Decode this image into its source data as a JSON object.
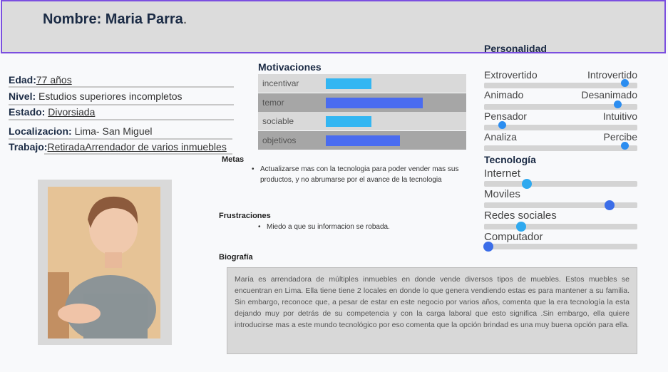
{
  "header": {
    "label": "Nombre:",
    "name": "Maria Parra",
    "suffix": "."
  },
  "profile": {
    "edad": {
      "label": "Edad:",
      "value": "77 años"
    },
    "nivel": {
      "label": "Nivel:",
      "value": "Estudios superiores incompletos"
    },
    "estado": {
      "label": "Estado:",
      "value": "Divorsiada"
    },
    "localizacion": {
      "label": "Localizacion:",
      "value": "Lima- San Miguel"
    },
    "trabajo": {
      "label": "Trabajo:",
      "value": "RetiradaArrendador de varios inmuebles"
    }
  },
  "motivaciones": {
    "title": "Motivaciones",
    "items": [
      {
        "label": "incentivar",
        "level": 0.22,
        "color": "#33b6f2",
        "shade": "#d9d9d9"
      },
      {
        "label": "temor",
        "level": 0.47,
        "color": "#4a6cf0",
        "shade": "#a6a6a6"
      },
      {
        "label": "sociable",
        "level": 0.22,
        "color": "#33b6f2",
        "shade": "#d9d9d9"
      },
      {
        "label": "objetivos",
        "level": 0.36,
        "color": "#4a6cf0",
        "shade": "#a6a6a6"
      }
    ]
  },
  "metas": {
    "title": "Metas",
    "items": [
      "Actualizarse mas con la tecnologia para poder vender mas sus productos, y no abrumarse por el avance de la tecnologia"
    ]
  },
  "frustraciones": {
    "title": "Frustraciones",
    "items": [
      "Miedo a que su informacion se robada."
    ]
  },
  "biografia": {
    "title": "Biografía",
    "text": "María es arrendadora de múltiples inmuebles en donde vende diversos tipos de muebles. Estos muebles se encuentran en Lima. Ella tiene tiene 2 locales en donde lo que genera vendiendo estas es para mantener a su familia. Sin embargo, reconoce que, a pesar de estar en este negocio por varios años, comenta que la era tecnología la esta dejando muy por detrás de su competencia y con la carga laboral que esto significa .Sin embargo, ella quiere introducirse mas a este mundo tecnológico por eso comenta que la opción brindad es una muy buena opción para ella."
  },
  "personalidad": {
    "title": "Personalidad",
    "items": [
      {
        "left": "Extrovertido",
        "right": "Introvertido",
        "value": 0.92
      },
      {
        "left": "Animado",
        "right": "Desanimado",
        "value": 0.87
      },
      {
        "left": "Pensador",
        "right": "Intuitivo",
        "value": 0.12
      },
      {
        "left": "Analiza",
        "right": "Percibe",
        "value": 0.92
      }
    ]
  },
  "tecnologia": {
    "title": "Tecnología",
    "items": [
      {
        "label": "Internet",
        "value": 0.28
      },
      {
        "label": "Moviles",
        "value": 0.82
      },
      {
        "label": "Redes sociales",
        "value": 0.24
      },
      {
        "label": "Computador",
        "value": 0.03
      }
    ]
  }
}
